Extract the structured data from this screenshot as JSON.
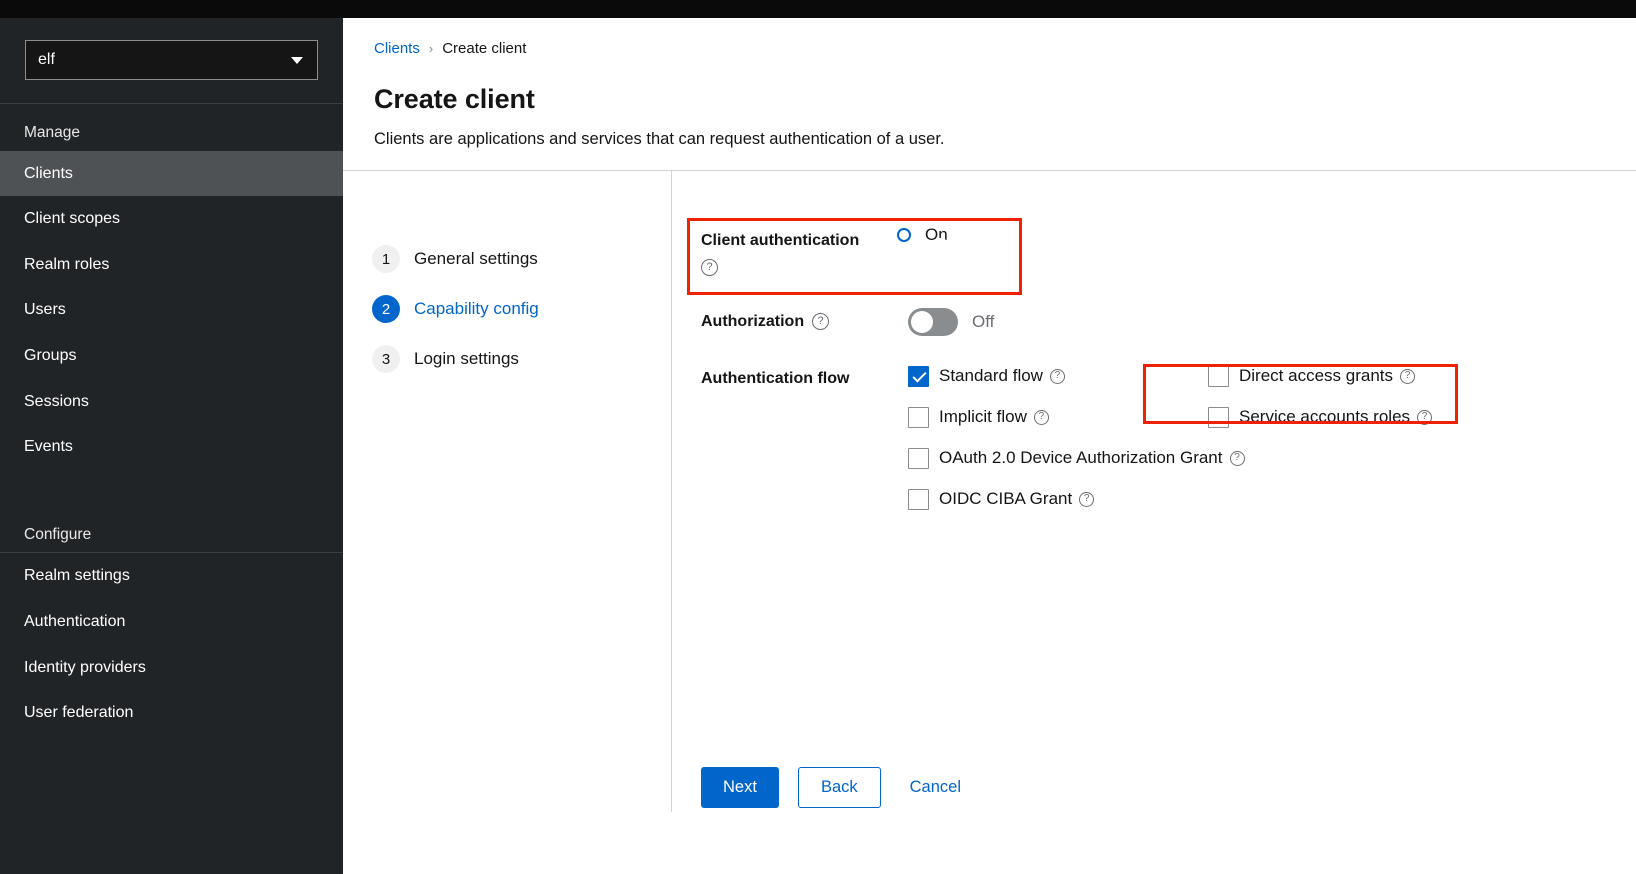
{
  "sidebar": {
    "realm_selector": {
      "value": "elf",
      "icon": "chevron-down-icon"
    },
    "sections": [
      {
        "title": "Manage",
        "items": [
          {
            "label": "Clients",
            "active": true
          },
          {
            "label": "Client scopes",
            "active": false
          },
          {
            "label": "Realm roles",
            "active": false
          },
          {
            "label": "Users",
            "active": false
          },
          {
            "label": "Groups",
            "active": false
          },
          {
            "label": "Sessions",
            "active": false
          },
          {
            "label": "Events",
            "active": false
          }
        ]
      },
      {
        "title": "Configure",
        "items": [
          {
            "label": "Realm settings",
            "active": false
          },
          {
            "label": "Authentication",
            "active": false
          },
          {
            "label": "Identity providers",
            "active": false
          },
          {
            "label": "User federation",
            "active": false
          }
        ]
      }
    ]
  },
  "header": {
    "breadcrumb": {
      "parent": "Clients",
      "separator": "›",
      "current": "Create client"
    },
    "title": "Create client",
    "subtitle": "Clients are applications and services that can request authentication of a user."
  },
  "wizard": {
    "steps": [
      {
        "num": "1",
        "label": "General settings",
        "current": false
      },
      {
        "num": "2",
        "label": "Capability config",
        "current": true
      },
      {
        "num": "3",
        "label": "Login settings",
        "current": false
      }
    ]
  },
  "form": {
    "client_authentication": {
      "label": "Client authentication",
      "help_icon": "question-circle-icon",
      "state_text": "On",
      "checked": true
    },
    "authorization": {
      "label": "Authorization",
      "help_icon": "question-circle-icon",
      "state_text": "Off",
      "checked": false
    },
    "authentication_flow": {
      "label": "Authentication flow",
      "left_column": [
        {
          "label": "Standard flow",
          "checked": true,
          "help_icon": "question-circle-icon"
        },
        {
          "label": "Implicit flow",
          "checked": false,
          "help_icon": "question-circle-icon"
        },
        {
          "label": "OAuth 2.0 Device Authorization Grant",
          "checked": false,
          "help_icon": "question-circle-icon"
        },
        {
          "label": "OIDC CIBA Grant",
          "checked": false,
          "help_icon": "question-circle-icon"
        }
      ],
      "right_column": [
        {
          "label": "Direct access grants",
          "checked": false,
          "help_icon": "question-circle-icon"
        },
        {
          "label": "Service accounts roles",
          "checked": false,
          "help_icon": "question-circle-icon"
        }
      ]
    }
  },
  "actions": {
    "next": "Next",
    "back": "Back",
    "cancel": "Cancel"
  },
  "colors": {
    "accent": "#0066cc",
    "highlight": "#ee2200",
    "sidebar_bg": "#212427",
    "sidebar_active": "#4f5255"
  },
  "help_glyph": "?"
}
